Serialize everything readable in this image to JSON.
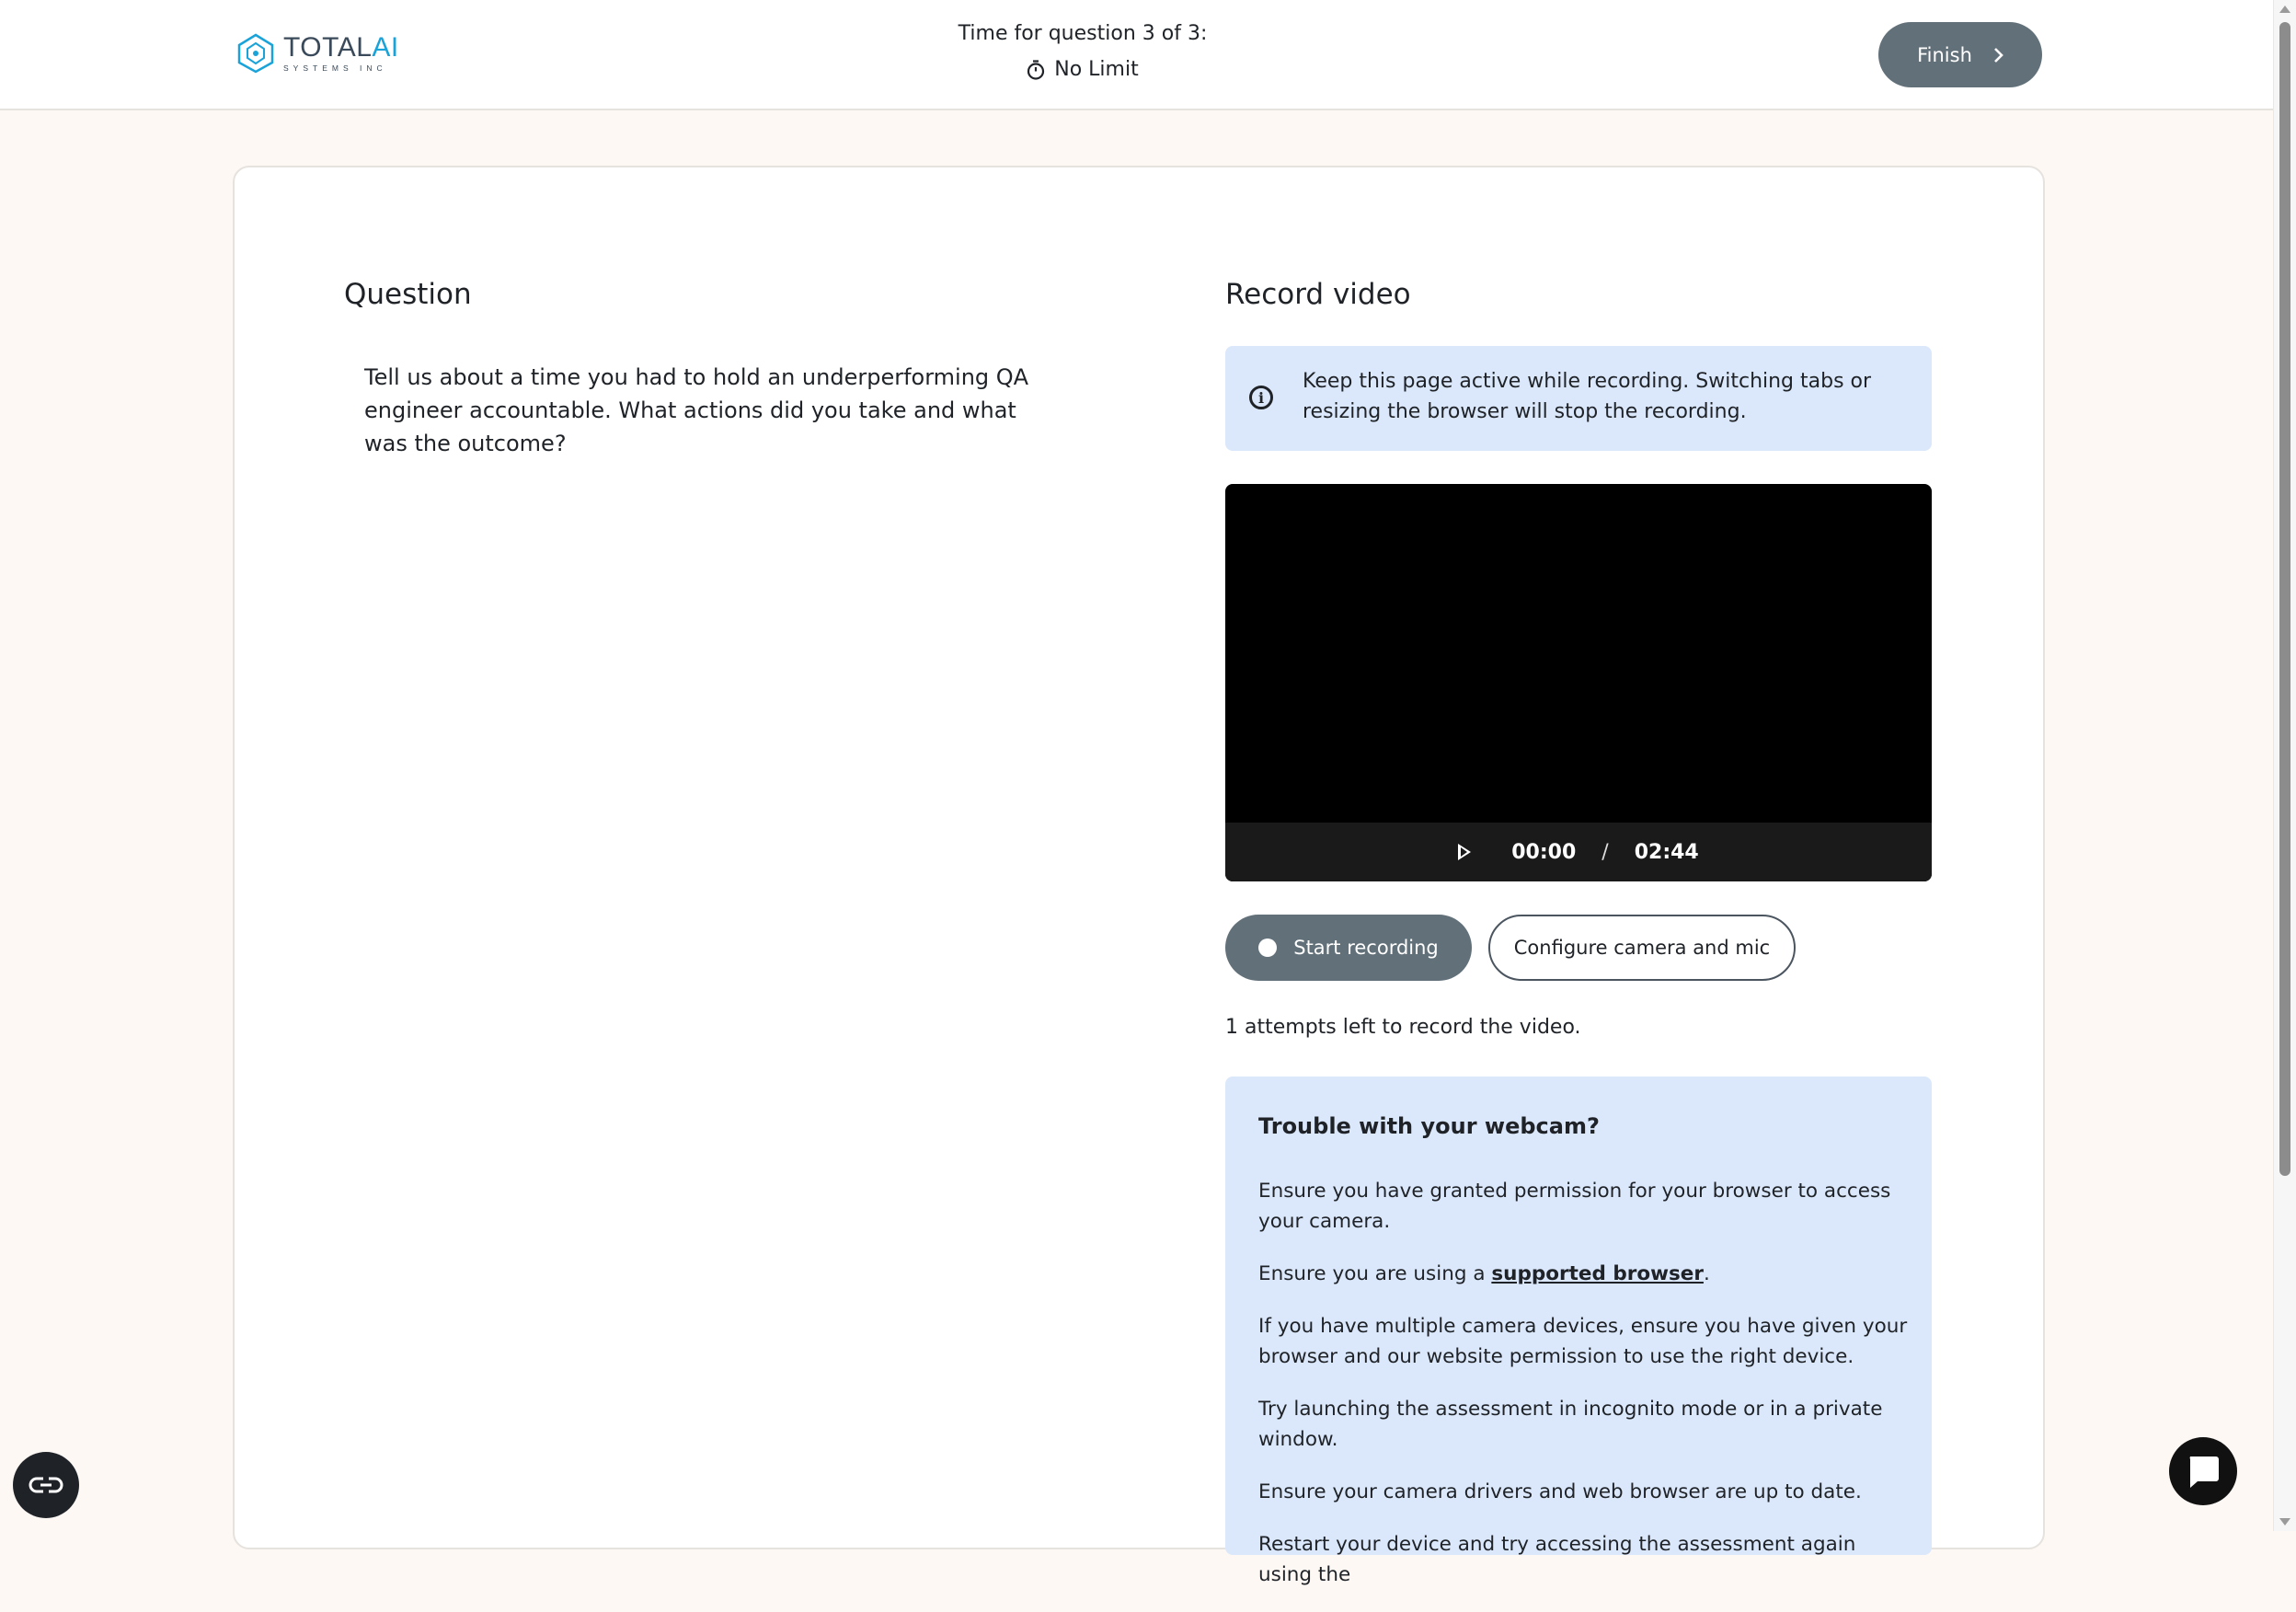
{
  "brand": {
    "name_prefix": "TOTAL",
    "name_suffix": "AI",
    "tagline": "SYSTEMS INC"
  },
  "header": {
    "timer_title": "Time for question 3 of 3:",
    "timer_value": "No Limit",
    "finish_label": "Finish"
  },
  "question": {
    "heading": "Question",
    "text": "Tell us about a time you had to hold an underperforming QA engineer accountable. What actions did you take and what was the outcome?"
  },
  "record": {
    "heading": "Record video",
    "info_text": "Keep this page active while recording. Switching tabs or resizing the browser will stop the recording.",
    "current_time": "00:00",
    "time_separator": "/",
    "duration": "02:44",
    "start_label": "Start recording",
    "configure_label": "Configure camera and mic",
    "attempts_text": "1 attempts left to record the video."
  },
  "trouble": {
    "title": "Trouble with your webcam?",
    "item1": "Ensure you have granted permission for your browser to access your camera.",
    "item2_prefix": "Ensure you are using a ",
    "item2_link": "supported browser",
    "item2_suffix": ".",
    "item3": "If you have multiple camera devices, ensure you have given your browser and our website permission to use the right device.",
    "item4": "Try launching the assessment in incognito mode or in a private window.",
    "item5": "Ensure your camera drivers and web browser are up to date.",
    "item6": "Restart your device and try accessing the assessment again using the"
  },
  "icons": {
    "logo": "totalai-logo-icon",
    "timer": "stopwatch-icon",
    "finish": "chevron-right-icon",
    "info": "info-icon",
    "play": "play-icon",
    "record": "record-dot-icon",
    "accessibility": "accessibility-icon",
    "chat": "chat-icon"
  },
  "colors": {
    "page_bg": "#fdf8f4",
    "button_bg": "#627079",
    "info_bg": "#dbe8fb",
    "brand_accent": "#1aa3d9"
  }
}
